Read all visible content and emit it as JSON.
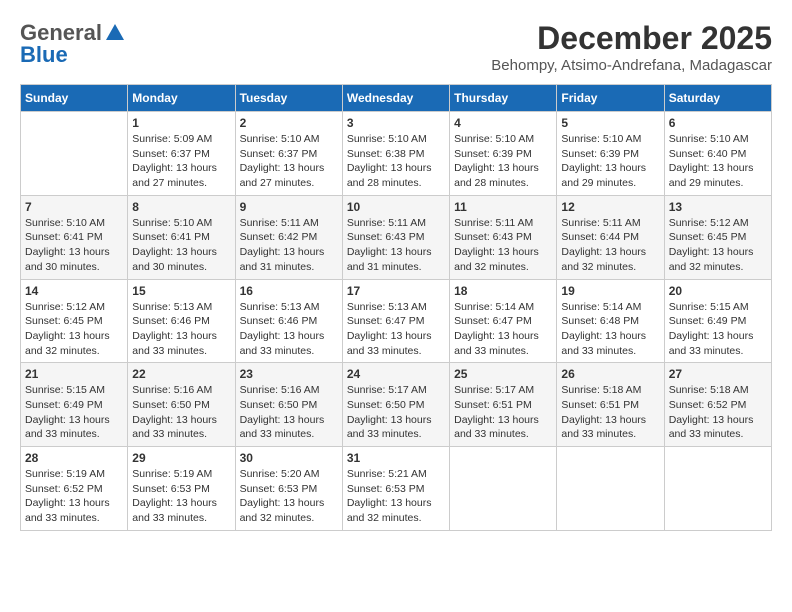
{
  "header": {
    "logo_general": "General",
    "logo_blue": "Blue",
    "month_year": "December 2025",
    "location": "Behompy, Atsimo-Andrefana, Madagascar"
  },
  "days_of_week": [
    "Sunday",
    "Monday",
    "Tuesday",
    "Wednesday",
    "Thursday",
    "Friday",
    "Saturday"
  ],
  "weeks": [
    [
      {
        "day": "",
        "info": ""
      },
      {
        "day": "1",
        "info": "Sunrise: 5:09 AM\nSunset: 6:37 PM\nDaylight: 13 hours\nand 27 minutes."
      },
      {
        "day": "2",
        "info": "Sunrise: 5:10 AM\nSunset: 6:37 PM\nDaylight: 13 hours\nand 27 minutes."
      },
      {
        "day": "3",
        "info": "Sunrise: 5:10 AM\nSunset: 6:38 PM\nDaylight: 13 hours\nand 28 minutes."
      },
      {
        "day": "4",
        "info": "Sunrise: 5:10 AM\nSunset: 6:39 PM\nDaylight: 13 hours\nand 28 minutes."
      },
      {
        "day": "5",
        "info": "Sunrise: 5:10 AM\nSunset: 6:39 PM\nDaylight: 13 hours\nand 29 minutes."
      },
      {
        "day": "6",
        "info": "Sunrise: 5:10 AM\nSunset: 6:40 PM\nDaylight: 13 hours\nand 29 minutes."
      }
    ],
    [
      {
        "day": "7",
        "info": "Sunrise: 5:10 AM\nSunset: 6:41 PM\nDaylight: 13 hours\nand 30 minutes."
      },
      {
        "day": "8",
        "info": "Sunrise: 5:10 AM\nSunset: 6:41 PM\nDaylight: 13 hours\nand 30 minutes."
      },
      {
        "day": "9",
        "info": "Sunrise: 5:11 AM\nSunset: 6:42 PM\nDaylight: 13 hours\nand 31 minutes."
      },
      {
        "day": "10",
        "info": "Sunrise: 5:11 AM\nSunset: 6:43 PM\nDaylight: 13 hours\nand 31 minutes."
      },
      {
        "day": "11",
        "info": "Sunrise: 5:11 AM\nSunset: 6:43 PM\nDaylight: 13 hours\nand 32 minutes."
      },
      {
        "day": "12",
        "info": "Sunrise: 5:11 AM\nSunset: 6:44 PM\nDaylight: 13 hours\nand 32 minutes."
      },
      {
        "day": "13",
        "info": "Sunrise: 5:12 AM\nSunset: 6:45 PM\nDaylight: 13 hours\nand 32 minutes."
      }
    ],
    [
      {
        "day": "14",
        "info": "Sunrise: 5:12 AM\nSunset: 6:45 PM\nDaylight: 13 hours\nand 32 minutes."
      },
      {
        "day": "15",
        "info": "Sunrise: 5:13 AM\nSunset: 6:46 PM\nDaylight: 13 hours\nand 33 minutes."
      },
      {
        "day": "16",
        "info": "Sunrise: 5:13 AM\nSunset: 6:46 PM\nDaylight: 13 hours\nand 33 minutes."
      },
      {
        "day": "17",
        "info": "Sunrise: 5:13 AM\nSunset: 6:47 PM\nDaylight: 13 hours\nand 33 minutes."
      },
      {
        "day": "18",
        "info": "Sunrise: 5:14 AM\nSunset: 6:47 PM\nDaylight: 13 hours\nand 33 minutes."
      },
      {
        "day": "19",
        "info": "Sunrise: 5:14 AM\nSunset: 6:48 PM\nDaylight: 13 hours\nand 33 minutes."
      },
      {
        "day": "20",
        "info": "Sunrise: 5:15 AM\nSunset: 6:49 PM\nDaylight: 13 hours\nand 33 minutes."
      }
    ],
    [
      {
        "day": "21",
        "info": "Sunrise: 5:15 AM\nSunset: 6:49 PM\nDaylight: 13 hours\nand 33 minutes."
      },
      {
        "day": "22",
        "info": "Sunrise: 5:16 AM\nSunset: 6:50 PM\nDaylight: 13 hours\nand 33 minutes."
      },
      {
        "day": "23",
        "info": "Sunrise: 5:16 AM\nSunset: 6:50 PM\nDaylight: 13 hours\nand 33 minutes."
      },
      {
        "day": "24",
        "info": "Sunrise: 5:17 AM\nSunset: 6:50 PM\nDaylight: 13 hours\nand 33 minutes."
      },
      {
        "day": "25",
        "info": "Sunrise: 5:17 AM\nSunset: 6:51 PM\nDaylight: 13 hours\nand 33 minutes."
      },
      {
        "day": "26",
        "info": "Sunrise: 5:18 AM\nSunset: 6:51 PM\nDaylight: 13 hours\nand 33 minutes."
      },
      {
        "day": "27",
        "info": "Sunrise: 5:18 AM\nSunset: 6:52 PM\nDaylight: 13 hours\nand 33 minutes."
      }
    ],
    [
      {
        "day": "28",
        "info": "Sunrise: 5:19 AM\nSunset: 6:52 PM\nDaylight: 13 hours\nand 33 minutes."
      },
      {
        "day": "29",
        "info": "Sunrise: 5:19 AM\nSunset: 6:53 PM\nDaylight: 13 hours\nand 33 minutes."
      },
      {
        "day": "30",
        "info": "Sunrise: 5:20 AM\nSunset: 6:53 PM\nDaylight: 13 hours\nand 32 minutes."
      },
      {
        "day": "31",
        "info": "Sunrise: 5:21 AM\nSunset: 6:53 PM\nDaylight: 13 hours\nand 32 minutes."
      },
      {
        "day": "",
        "info": ""
      },
      {
        "day": "",
        "info": ""
      },
      {
        "day": "",
        "info": ""
      }
    ]
  ]
}
